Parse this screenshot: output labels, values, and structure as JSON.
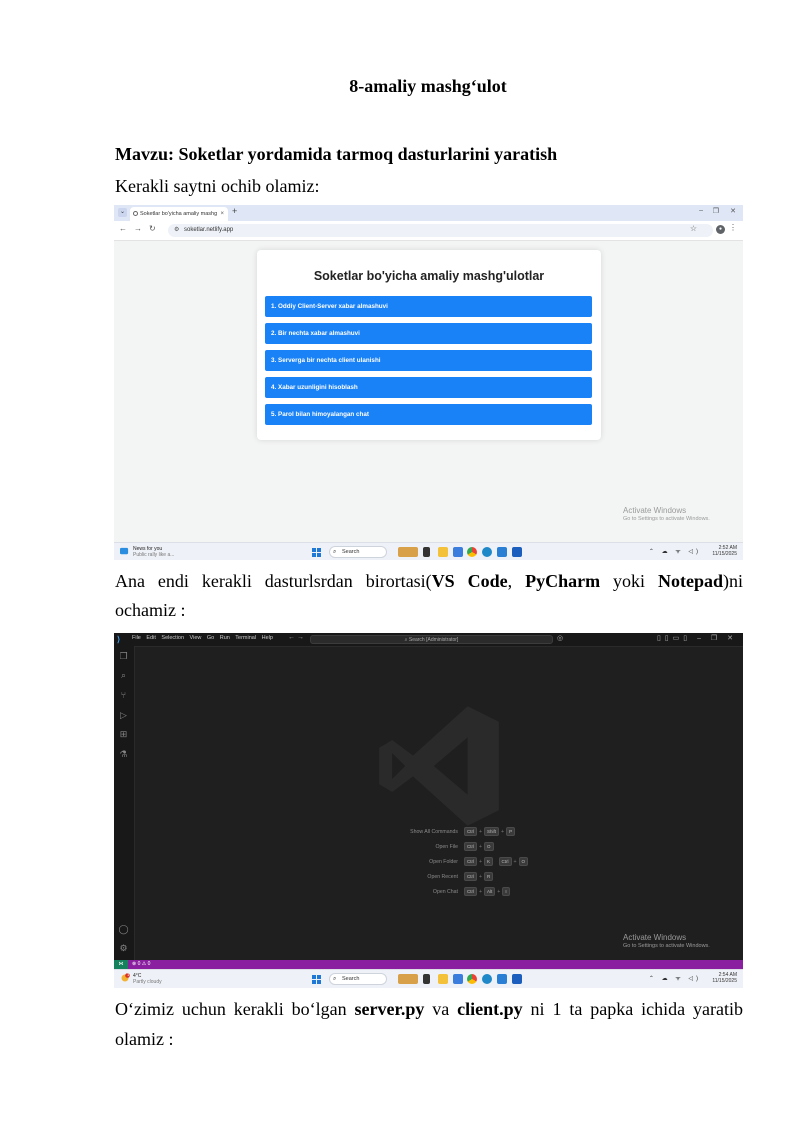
{
  "document": {
    "heading": "8-amaliy mashg‘ulot",
    "topic_label": "Mavzu: Soketlar yordamida tarmoq dasturlarini yaratish",
    "para1": "Kerakli saytni ochib olamiz:",
    "para2_line1_pre": "Ana endi kerakli dasturlsrdan birortasi(",
    "para2_vscode": "VS Code",
    "para2_comma": ", ",
    "para2_pycharm": "PyCharm",
    "para2_yoki": " yoki ",
    "para2_notepad": "Notepad",
    "para2_post": ")ni",
    "para2_line2": "ochamiz :",
    "para3_pre": "O‘zimiz uchun kerakli bo‘lgan ",
    "para3_server": "server.py",
    "para3_va": " va ",
    "para3_client": "client.py",
    "para3_post": " ni 1 ta papka ichida yaratib",
    "para3_line2": "olamiz :"
  },
  "browser": {
    "tab_title": "Soketlar bo'yicha amaliy mashg",
    "url": "soketlar.netlify.app",
    "page_title": "Soketlar bo'yicha amaliy mashg'ulotlar",
    "items": [
      "1. Oddiy Client-Server xabar almashuvi",
      "2. Bir nechta xabar almashuvi",
      "3. Serverga bir nechta client ulanishi",
      "4. Xabar uzunligini hisoblash",
      "5. Parol bilan himoyalangan chat"
    ],
    "activate_title": "Activate Windows",
    "activate_sub": "Go to Settings to activate Windows."
  },
  "taskbar1": {
    "news_title": "News for you",
    "news_sub": "Public rally like a...",
    "search": "Search",
    "time": "2:52 AM",
    "date": "11/15/2025"
  },
  "vscode": {
    "menu": "File Edit Selection View Go Run Terminal Help",
    "search": "Search [Administrator]",
    "shortcuts": [
      {
        "label": "Show All Commands",
        "keys": [
          "Ctrl",
          "Shift",
          "P"
        ]
      },
      {
        "label": "Open File",
        "keys": [
          "Ctrl",
          "O"
        ]
      },
      {
        "label": "Open Folder",
        "keys": [
          "Ctrl",
          "K",
          "Ctrl",
          "O"
        ]
      },
      {
        "label": "Open Recent",
        "keys": [
          "Ctrl",
          "R"
        ]
      },
      {
        "label": "Open Chat",
        "keys": [
          "Ctrl",
          "Alt",
          "I"
        ]
      }
    ],
    "status": "⊗ 0 ⚠ 0",
    "activate_title": "Activate Windows",
    "activate_sub": "Go to Settings to activate Windows."
  },
  "taskbar2": {
    "weather_temp": "4°C",
    "weather_sub": "Partly cloudy",
    "badge": "1",
    "search": "Search",
    "time": "2:54 AM",
    "date": "11/15/2025"
  }
}
